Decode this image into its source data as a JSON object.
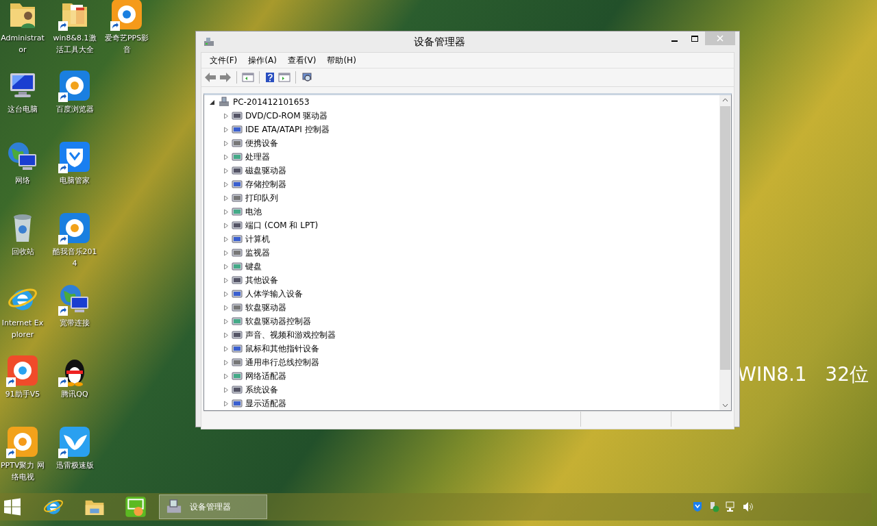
{
  "desktop": {
    "icon_rows": [
      [
        {
          "label": "Administrator",
          "kind": "user-folder",
          "shortcut": false
        },
        {
          "label": "win8&8.1激活工具大全",
          "kind": "folder",
          "shortcut": true
        },
        {
          "label": "爱奇艺PPS影音",
          "kind": "app",
          "shortcut": true
        }
      ],
      [
        {
          "label": "这台电脑",
          "kind": "computer",
          "shortcut": false
        },
        {
          "label": "百度浏览器",
          "kind": "app",
          "shortcut": true
        }
      ],
      [
        {
          "label": "网络",
          "kind": "network",
          "shortcut": false
        },
        {
          "label": "电脑管家",
          "kind": "shield",
          "shortcut": true
        }
      ],
      [
        {
          "label": "回收站",
          "kind": "recycle-bin",
          "shortcut": false
        },
        {
          "label": "酷我音乐2014",
          "kind": "app",
          "shortcut": true
        }
      ],
      [
        {
          "label": "Internet Explorer",
          "kind": "browser",
          "shortcut": false
        },
        {
          "label": "宽带连接",
          "kind": "network",
          "shortcut": true
        }
      ],
      [
        {
          "label": "91助手V5",
          "kind": "app",
          "shortcut": true
        },
        {
          "label": "腾讯QQ",
          "kind": "penguin",
          "shortcut": true
        }
      ],
      [
        {
          "label": "PPTV聚力 网络电视",
          "kind": "app",
          "shortcut": true
        },
        {
          "label": "迅雷极速版",
          "kind": "bird",
          "shortcut": true
        }
      ]
    ],
    "banner": "WIN8.1   32位"
  },
  "window": {
    "title": "设备管理器",
    "menu": [
      "文件(F)",
      "操作(A)",
      "查看(V)",
      "帮助(H)"
    ],
    "tree": {
      "label": "PC-201412101653",
      "expanded": true,
      "children": [
        {
          "label": "DVD/CD-ROM 驱动器",
          "expanded": false
        },
        {
          "label": "IDE ATA/ATAPI 控制器",
          "expanded": false
        },
        {
          "label": "便携设备",
          "expanded": false
        },
        {
          "label": "处理器",
          "expanded": false
        },
        {
          "label": "磁盘驱动器",
          "expanded": false
        },
        {
          "label": "存储控制器",
          "expanded": false
        },
        {
          "label": "打印队列",
          "expanded": false
        },
        {
          "label": "电池",
          "expanded": false
        },
        {
          "label": "端口 (COM 和 LPT)",
          "expanded": false
        },
        {
          "label": "计算机",
          "expanded": false
        },
        {
          "label": "监视器",
          "expanded": false
        },
        {
          "label": "键盘",
          "expanded": false
        },
        {
          "label": "其他设备",
          "expanded": false
        },
        {
          "label": "人体学输入设备",
          "expanded": false
        },
        {
          "label": "软盘驱动器",
          "expanded": false
        },
        {
          "label": "软盘驱动器控制器",
          "expanded": false
        },
        {
          "label": "声音、视频和游戏控制器",
          "expanded": false
        },
        {
          "label": "鼠标和其他指针设备",
          "expanded": false
        },
        {
          "label": "通用串行总线控制器",
          "expanded": false
        },
        {
          "label": "网络适配器",
          "expanded": false
        },
        {
          "label": "系统设备",
          "expanded": false
        },
        {
          "label": "显示适配器",
          "expanded": false
        }
      ]
    }
  },
  "taskbar": {
    "pinned": [
      {
        "kind": "start"
      },
      {
        "kind": "browser"
      },
      {
        "kind": "folder"
      },
      {
        "kind": "app"
      }
    ],
    "tasks": [
      {
        "label": "设备管理器",
        "selected": true
      }
    ]
  }
}
